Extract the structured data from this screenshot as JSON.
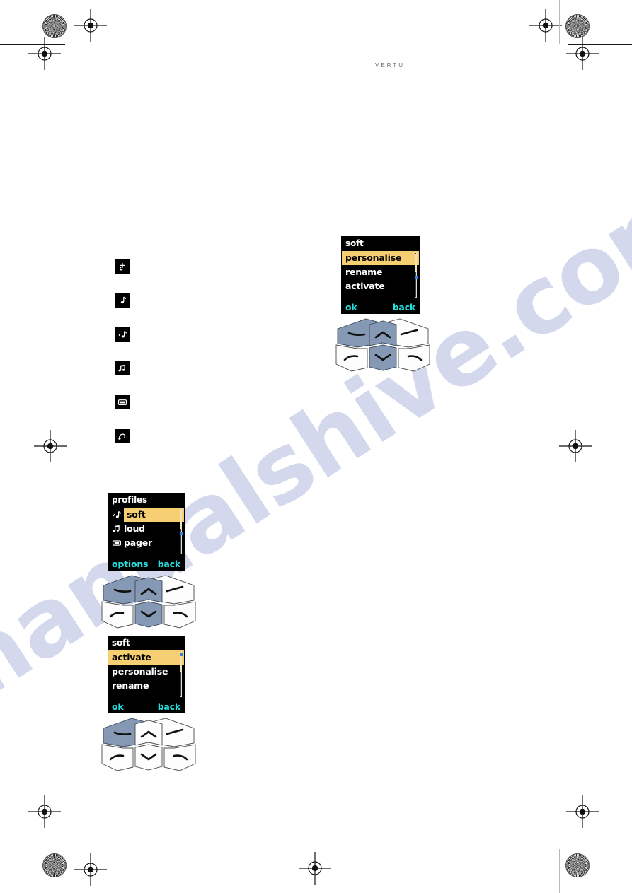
{
  "page": {
    "brand": "VERTU",
    "watermark": "manualshive.com"
  },
  "icon_list": {
    "items": [
      {
        "name": "silent-icon",
        "glyph": "silent"
      },
      {
        "name": "soft-icon",
        "glyph": "single-note"
      },
      {
        "name": "general-icon",
        "glyph": "note-with-flag"
      },
      {
        "name": "loud-icon",
        "glyph": "double-note"
      },
      {
        "name": "pager-icon",
        "glyph": "pager"
      },
      {
        "name": "headset-icon",
        "glyph": "headset"
      }
    ]
  },
  "screens": {
    "soft_options_top": {
      "title": "soft",
      "items": [
        {
          "label": "personalise",
          "selected": true
        },
        {
          "label": "rename",
          "selected": false
        },
        {
          "label": "activate",
          "selected": false
        }
      ],
      "left_softkey": "ok",
      "right_softkey": "back"
    },
    "profiles": {
      "title": "profiles",
      "items": [
        {
          "label": "soft",
          "icon": "note-with-flag",
          "selected": true
        },
        {
          "label": "loud",
          "icon": "double-note",
          "selected": false
        },
        {
          "label": "pager",
          "icon": "pager",
          "selected": false
        }
      ],
      "left_softkey": "options",
      "right_softkey": "back"
    },
    "soft_options_bottom": {
      "title": "soft",
      "items": [
        {
          "label": "activate",
          "selected": true
        },
        {
          "label": "personalise",
          "selected": false
        },
        {
          "label": "rename",
          "selected": false
        }
      ],
      "left_softkey": "ok",
      "right_softkey": "back"
    }
  },
  "keypads": [
    {
      "name": "keypad-diagram-top",
      "keys": {
        "left_softkey": "highlighted",
        "right_softkey": "normal",
        "scroll_up": "highlighted",
        "scroll_down": "highlighted",
        "call": "normal",
        "end": "normal"
      }
    },
    {
      "name": "keypad-diagram-middle",
      "keys": {
        "left_softkey": "highlighted",
        "right_softkey": "normal",
        "scroll_up": "highlighted",
        "scroll_down": "highlighted",
        "call": "normal",
        "end": "normal"
      }
    },
    {
      "name": "keypad-diagram-bottom",
      "keys": {
        "left_softkey": "highlighted",
        "right_softkey": "normal",
        "scroll_up": "normal",
        "scroll_down": "normal",
        "call": "normal",
        "end": "normal"
      }
    }
  ],
  "colors": {
    "screen_bg": "#000000",
    "selection": "#f6cf72",
    "softkey_text": "#25e0e0",
    "key_highlight": "#8598b4",
    "watermark": "#c6cbe8"
  }
}
